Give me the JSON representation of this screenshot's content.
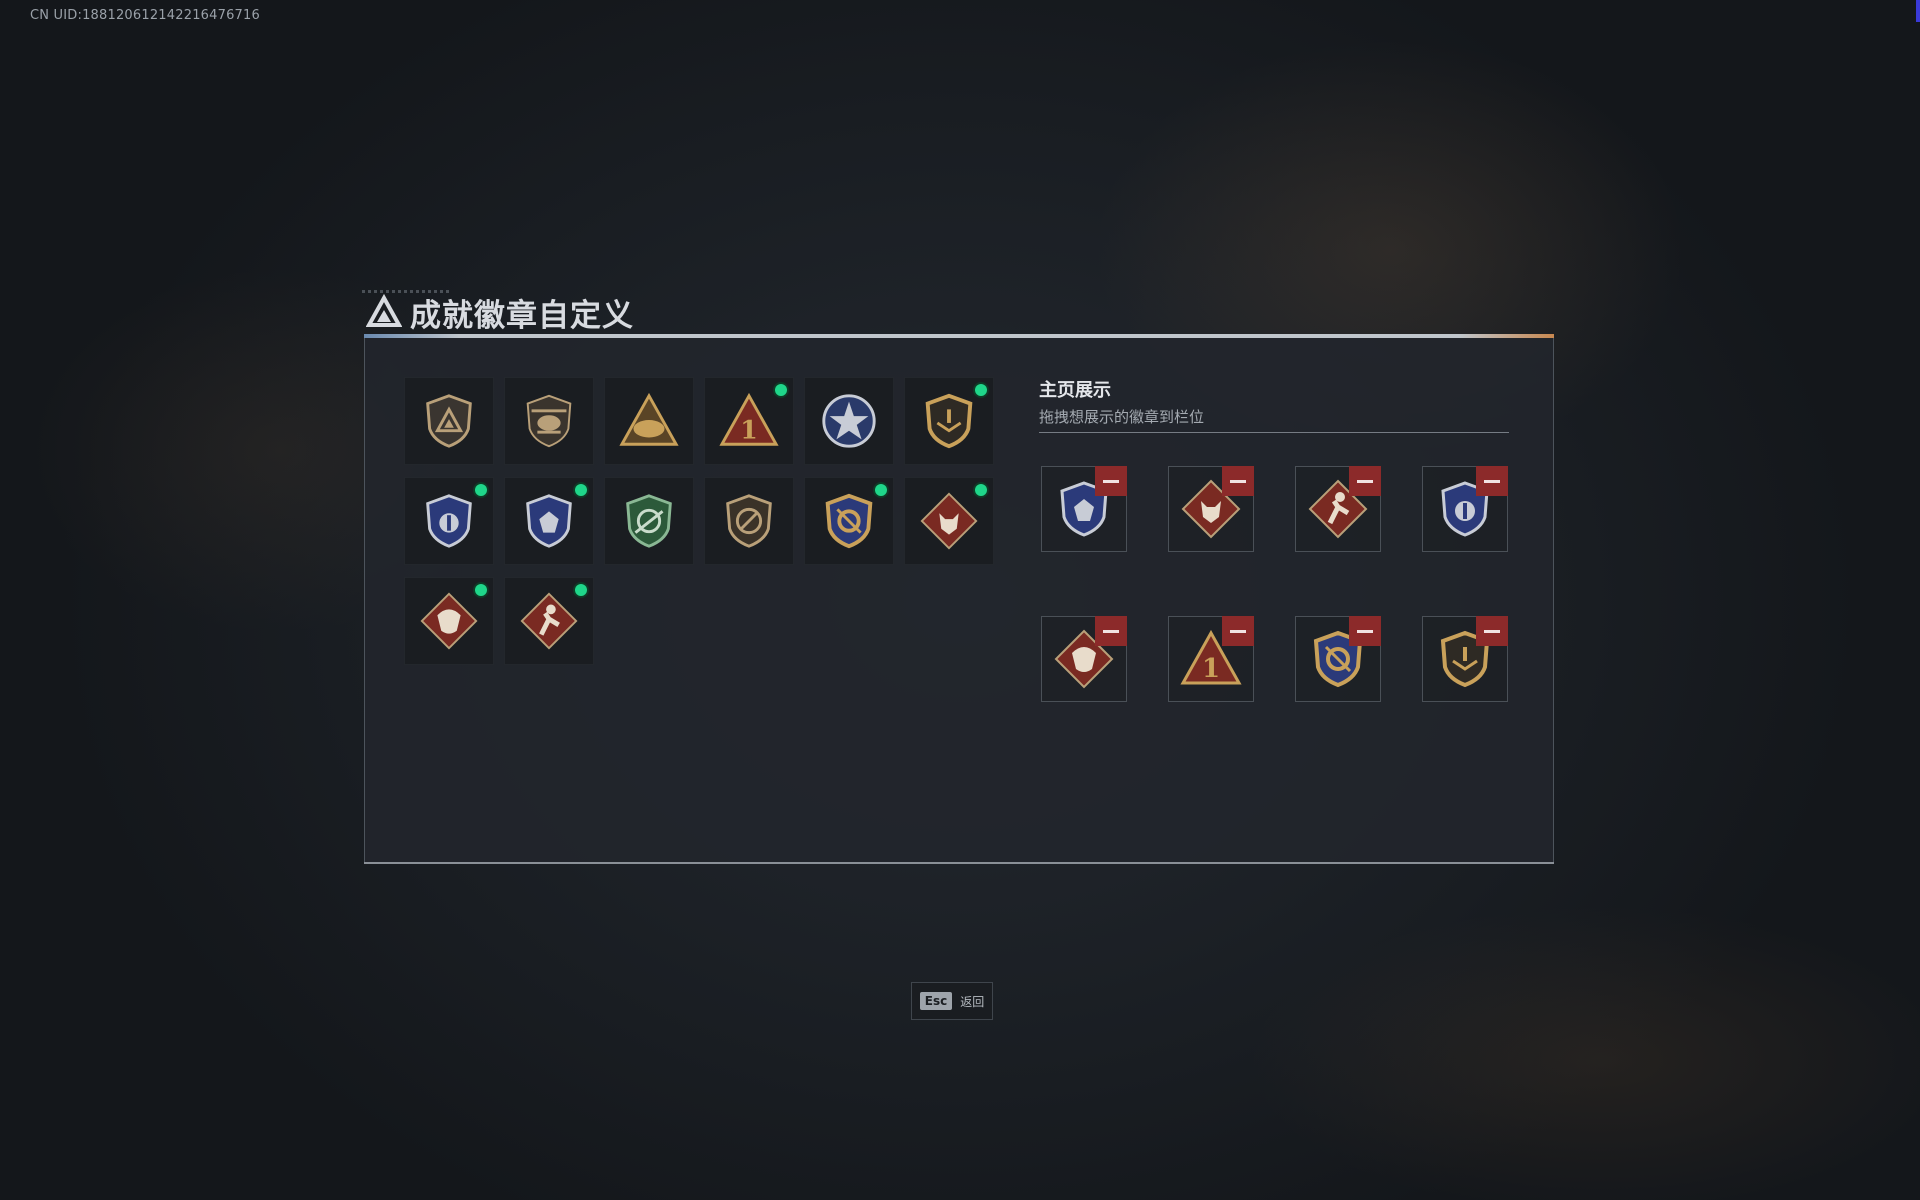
{
  "uid_text": "CN UID:1881206121422164767​16",
  "header": {
    "title": "成就徽章自定义",
    "icon": "triangle-logo-icon"
  },
  "showcase": {
    "title": "主页展示",
    "subtitle": "拖拽想展示的徽章到栏位"
  },
  "badges": [
    {
      "icon": "triangle-shield-badge-icon",
      "new": false
    },
    {
      "icon": "helicopter-badge-icon",
      "new": false
    },
    {
      "icon": "helmet-triangle-badge-icon",
      "new": false
    },
    {
      "icon": "number-one-triangle-badge-icon",
      "new": true
    },
    {
      "icon": "star-emblem-badge-icon",
      "new": false
    },
    {
      "icon": "gold-shield-badge-icon",
      "new": true
    },
    {
      "icon": "blue-shield-badge-icon",
      "new": true
    },
    {
      "icon": "blue-gem-shield-badge-icon",
      "new": true
    },
    {
      "icon": "green-crosshair-badge-icon",
      "new": false
    },
    {
      "icon": "no-gun-shield-badge-icon",
      "new": false
    },
    {
      "icon": "gold-crest-badge-icon",
      "new": true
    },
    {
      "icon": "wolf-diamond-badge-icon",
      "new": true
    },
    {
      "icon": "dragon-diamond-badge-icon",
      "new": true
    },
    {
      "icon": "runner-diamond-badge-icon",
      "new": true
    }
  ],
  "slots": [
    {
      "icon": "blue-gem-shield-badge-icon"
    },
    {
      "icon": "wolf-diamond-badge-icon"
    },
    {
      "icon": "runner-diamond-badge-icon"
    },
    {
      "icon": "blue-shield-badge-icon"
    },
    {
      "icon": "dragon-diamond-badge-icon"
    },
    {
      "icon": "number-one-triangle-badge-icon"
    },
    {
      "icon": "gold-crest-badge-icon"
    },
    {
      "icon": "gold-shield-badge-icon"
    }
  ],
  "footer": {
    "key": "Esc",
    "label": "返回"
  },
  "colors": {
    "new_dot": "#1fd68a",
    "remove": "#8c2a2a",
    "accent_gold": "#c9a15a"
  }
}
